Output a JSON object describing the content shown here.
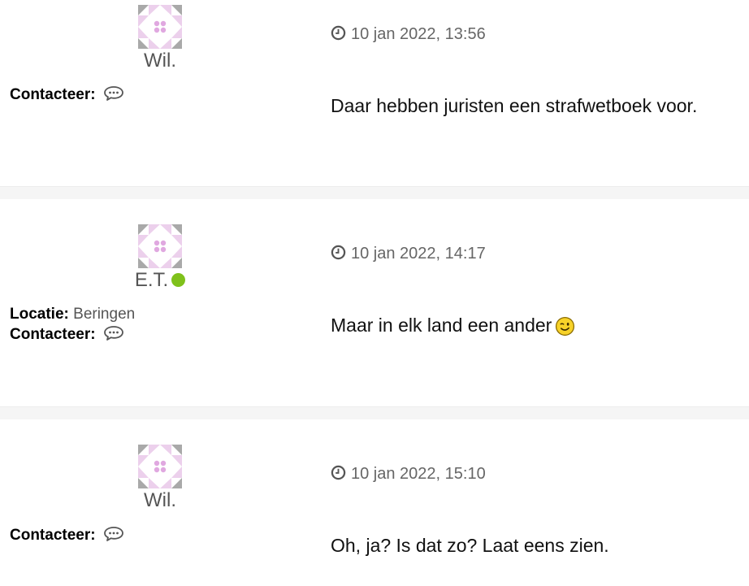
{
  "posts": [
    {
      "author": "Wil.",
      "date": "10 jan 2022, 13:56",
      "contact_label": "Contacteer:",
      "body": "Daar hebben juristen een strafwetboek voor."
    },
    {
      "author": "E.T.",
      "online": true,
      "location_label": "Locatie:",
      "location_value": "Beringen",
      "date": "10 jan 2022, 14:17",
      "contact_label": "Contacteer:",
      "body": "Maar in elk land een ander",
      "emoticon": "wink-smiley-icon"
    },
    {
      "author": "Wil.",
      "date": "10 jan 2022, 15:10",
      "contact_label": "Contacteer:",
      "body": "Oh, ja? Is dat zo? Laat eens zien."
    }
  ],
  "icons": {
    "date": "clock-icon",
    "contact": "chat-bubble-icon",
    "avatar": "quilt-pattern-avatar"
  },
  "colors": {
    "online": "#7fc11b",
    "separator": "#f5f5f5",
    "avatar_accent": "#e8b6e8",
    "avatar_gray": "#a9a9a9"
  }
}
